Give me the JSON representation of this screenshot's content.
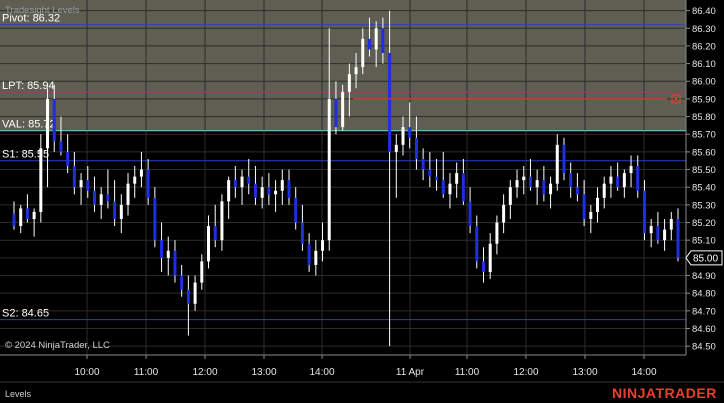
{
  "indicator_name": "Tradesight Levels",
  "copyright": "© 2024 NinjaTrader, LLC",
  "panel_tab": "Levels",
  "brand": {
    "text": "NINJATRADER",
    "color": "#e8412c"
  },
  "current_price_label": "85.00",
  "chart_data": {
    "type": "candlestick",
    "x_ticks": [
      "10:00",
      "11:00",
      "12:00",
      "13:00",
      "14:00",
      "11 Apr",
      "11:00",
      "12:00",
      "13:00",
      "14:00"
    ],
    "y_ticks": [
      "86.40",
      "86.30",
      "86.20",
      "86.10",
      "86.00",
      "85.90",
      "85.80",
      "85.70",
      "85.60",
      "85.50",
      "85.40",
      "85.30",
      "85.20",
      "85.10",
      "85.00",
      "84.90",
      "84.80",
      "84.70",
      "84.60",
      "84.50"
    ],
    "ylim": [
      84.45,
      86.46
    ],
    "current_price": 85.0,
    "levels": [
      {
        "name": "Pivot",
        "label": "Pivot: 86.32",
        "value": 86.32,
        "color": "#2a3fc4"
      },
      {
        "name": "LPT",
        "label": "LPT: 85.94",
        "value": 85.94,
        "color": "#b0336e"
      },
      {
        "name": "VAL",
        "label": "VAL: 85.72",
        "value": 85.72,
        "color": "#5fd9d9"
      },
      {
        "name": "S1",
        "label": "S1: 85.55",
        "value": 85.55,
        "color": "#2a3fc4"
      },
      {
        "name": "S2",
        "label": "S2: 84.65",
        "value": 84.65,
        "color": "#2a3fc4"
      }
    ],
    "order_line": {
      "value": 85.9,
      "color": "#e8412c"
    },
    "shaded_zone": {
      "from": 85.72,
      "to": 86.46,
      "color": "#5e5e52"
    },
    "up_color": "#ffffff",
    "down_color": "#1f2ee0",
    "ohlc": [
      [
        85.25,
        85.32,
        85.16,
        85.18
      ],
      [
        85.18,
        85.3,
        85.14,
        85.28
      ],
      [
        85.28,
        85.36,
        85.2,
        85.22
      ],
      [
        85.22,
        85.28,
        85.12,
        85.26
      ],
      [
        85.26,
        85.7,
        85.2,
        85.62
      ],
      [
        85.62,
        85.96,
        85.4,
        85.9
      ],
      [
        85.9,
        85.98,
        85.6,
        85.66
      ],
      [
        85.66,
        85.8,
        85.58,
        85.6
      ],
      [
        85.6,
        85.7,
        85.48,
        85.52
      ],
      [
        85.52,
        85.6,
        85.36,
        85.4
      ],
      [
        85.4,
        85.48,
        85.3,
        85.44
      ],
      [
        85.44,
        85.52,
        85.34,
        85.38
      ],
      [
        85.38,
        85.46,
        85.26,
        85.3
      ],
      [
        85.3,
        85.4,
        85.22,
        85.36
      ],
      [
        85.36,
        85.5,
        85.28,
        85.32
      ],
      [
        85.32,
        85.44,
        85.18,
        85.22
      ],
      [
        85.22,
        85.36,
        85.14,
        85.3
      ],
      [
        85.3,
        85.48,
        85.24,
        85.42
      ],
      [
        85.42,
        85.52,
        85.34,
        85.46
      ],
      [
        85.46,
        85.6,
        85.4,
        85.5
      ],
      [
        85.5,
        85.56,
        85.3,
        85.34
      ],
      [
        85.34,
        85.4,
        85.06,
        85.1
      ],
      [
        85.1,
        85.2,
        84.92,
        85.0
      ],
      [
        85.0,
        85.12,
        84.9,
        85.04
      ],
      [
        85.04,
        85.1,
        84.86,
        84.9
      ],
      [
        84.9,
        84.96,
        84.78,
        84.82
      ],
      [
        84.82,
        84.9,
        84.56,
        84.74
      ],
      [
        84.74,
        84.9,
        84.7,
        84.86
      ],
      [
        84.86,
        85.02,
        84.82,
        84.98
      ],
      [
        84.98,
        85.24,
        84.94,
        85.18
      ],
      [
        85.18,
        85.3,
        85.06,
        85.1
      ],
      [
        85.1,
        85.36,
        85.04,
        85.32
      ],
      [
        85.32,
        85.46,
        85.22,
        85.44
      ],
      [
        85.44,
        85.52,
        85.34,
        85.4
      ],
      [
        85.4,
        85.5,
        85.3,
        85.46
      ],
      [
        85.46,
        85.56,
        85.36,
        85.42
      ],
      [
        85.42,
        85.52,
        85.3,
        85.34
      ],
      [
        85.34,
        85.46,
        85.28,
        85.4
      ],
      [
        85.4,
        85.48,
        85.3,
        85.36
      ],
      [
        85.36,
        85.44,
        85.26,
        85.38
      ],
      [
        85.38,
        85.5,
        85.3,
        85.44
      ],
      [
        85.44,
        85.5,
        85.3,
        85.34
      ],
      [
        85.34,
        85.4,
        85.16,
        85.2
      ],
      [
        85.2,
        85.3,
        85.04,
        85.08
      ],
      [
        85.08,
        85.14,
        84.92,
        84.96
      ],
      [
        84.96,
        85.1,
        84.9,
        85.04
      ],
      [
        85.04,
        85.2,
        84.98,
        85.1
      ],
      [
        85.1,
        86.3,
        85.04,
        85.9
      ],
      [
        85.9,
        86.0,
        85.7,
        85.74
      ],
      [
        85.74,
        85.98,
        85.72,
        85.94
      ],
      [
        85.94,
        86.1,
        85.8,
        86.04
      ],
      [
        86.04,
        86.16,
        85.96,
        86.08
      ],
      [
        86.08,
        86.3,
        86.04,
        86.24
      ],
      [
        86.24,
        86.36,
        86.14,
        86.18
      ],
      [
        86.18,
        86.34,
        86.08,
        86.3
      ],
      [
        86.3,
        86.36,
        86.1,
        86.16
      ],
      [
        86.16,
        86.4,
        84.5,
        85.6
      ],
      [
        85.6,
        85.7,
        85.34,
        85.64
      ],
      [
        85.64,
        85.8,
        85.58,
        85.74
      ],
      [
        85.74,
        85.88,
        85.62,
        85.68
      ],
      [
        85.68,
        85.8,
        85.5,
        85.56
      ],
      [
        85.56,
        85.62,
        85.44,
        85.5
      ],
      [
        85.5,
        85.6,
        85.4,
        85.46
      ],
      [
        85.46,
        85.56,
        85.38,
        85.44
      ],
      [
        85.44,
        85.6,
        85.34,
        85.36
      ],
      [
        85.36,
        85.48,
        85.28,
        85.42
      ],
      [
        85.42,
        85.54,
        85.34,
        85.48
      ],
      [
        85.48,
        85.56,
        85.3,
        85.32
      ],
      [
        85.32,
        85.4,
        85.14,
        85.18
      ],
      [
        85.18,
        85.24,
        84.94,
        84.98
      ],
      [
        84.98,
        85.06,
        84.86,
        84.92
      ],
      [
        84.92,
        85.14,
        84.88,
        85.08
      ],
      [
        85.08,
        85.24,
        85.02,
        85.2
      ],
      [
        85.2,
        85.36,
        85.14,
        85.3
      ],
      [
        85.3,
        85.44,
        85.22,
        85.4
      ],
      [
        85.4,
        85.5,
        85.34,
        85.44
      ],
      [
        85.44,
        85.52,
        85.36,
        85.46
      ],
      [
        85.46,
        85.56,
        85.38,
        85.4
      ],
      [
        85.4,
        85.5,
        85.3,
        85.44
      ],
      [
        85.44,
        85.52,
        85.32,
        85.36
      ],
      [
        85.36,
        85.46,
        85.28,
        85.42
      ],
      [
        85.42,
        85.7,
        85.38,
        85.64
      ],
      [
        85.64,
        85.68,
        85.44,
        85.48
      ],
      [
        85.48,
        85.54,
        85.34,
        85.4
      ],
      [
        85.4,
        85.48,
        85.32,
        85.36
      ],
      [
        85.36,
        85.44,
        85.18,
        85.22
      ],
      [
        85.22,
        85.3,
        85.14,
        85.26
      ],
      [
        85.26,
        85.4,
        85.2,
        85.34
      ],
      [
        85.34,
        85.46,
        85.28,
        85.42
      ],
      [
        85.42,
        85.52,
        85.34,
        85.46
      ],
      [
        85.46,
        85.54,
        85.38,
        85.4
      ],
      [
        85.4,
        85.5,
        85.34,
        85.48
      ],
      [
        85.48,
        85.58,
        85.4,
        85.52
      ],
      [
        85.52,
        85.58,
        85.34,
        85.38
      ],
      [
        85.38,
        85.44,
        85.1,
        85.14
      ],
      [
        85.14,
        85.22,
        85.06,
        85.18
      ],
      [
        85.18,
        85.26,
        85.08,
        85.1
      ],
      [
        85.1,
        85.22,
        85.04,
        85.16
      ],
      [
        85.16,
        85.26,
        85.1,
        85.22
      ],
      [
        85.22,
        85.28,
        84.98,
        85.0
      ]
    ]
  }
}
